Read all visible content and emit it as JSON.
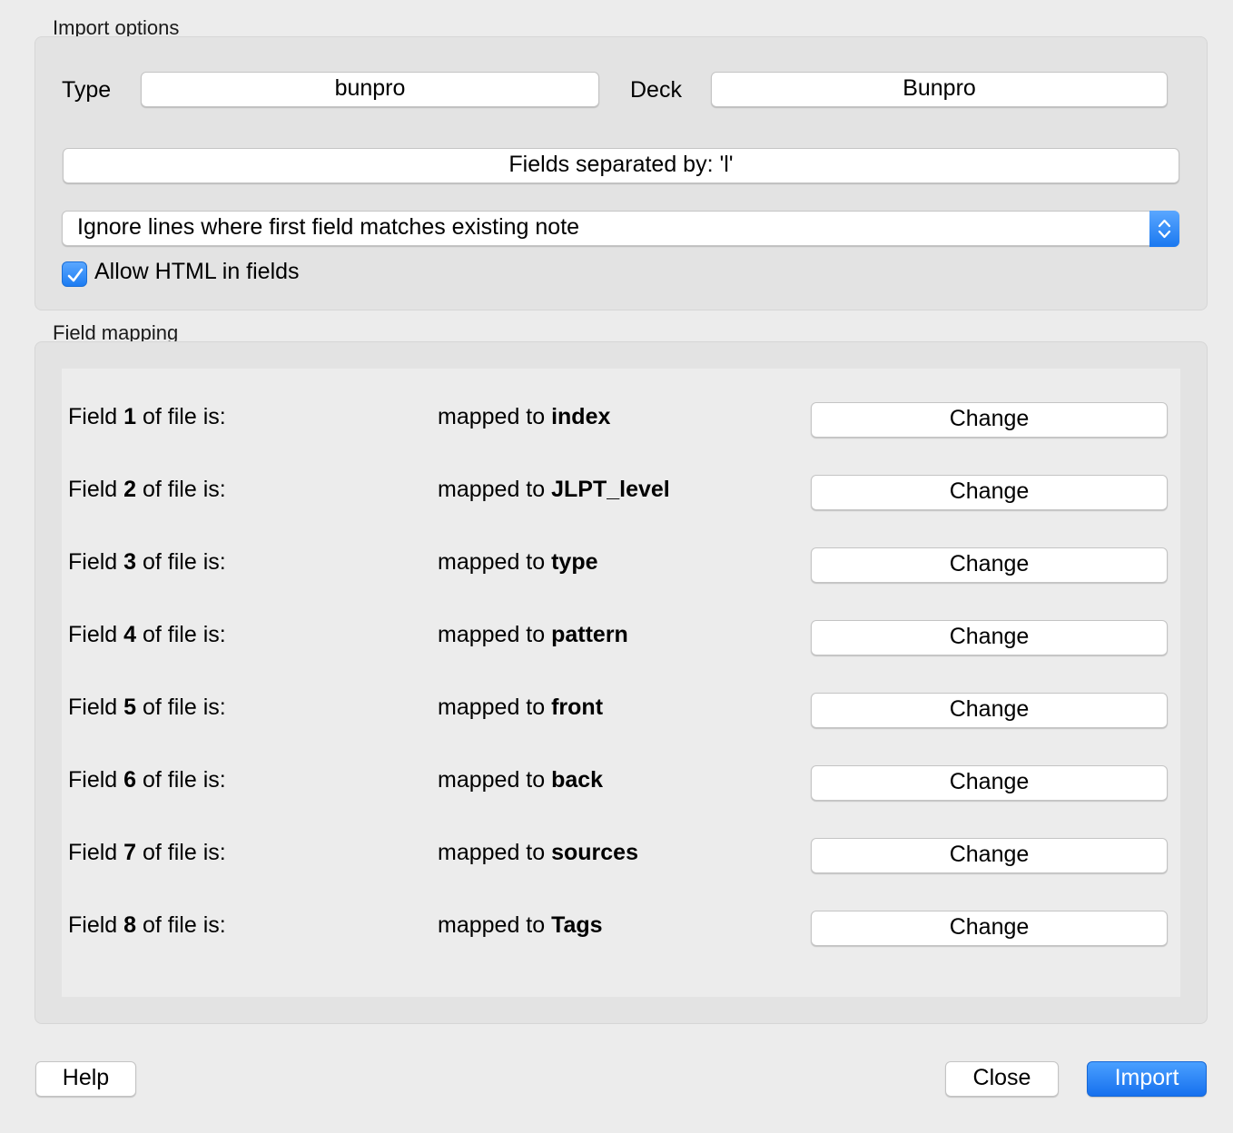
{
  "import_options": {
    "title": "Import options",
    "type_label": "Type",
    "type_value": "bunpro",
    "deck_label": "Deck",
    "deck_value": "Bunpro",
    "separator_button": "Fields separated by: 'l'",
    "duplicate_mode": "Ignore lines where first field matches existing note",
    "allow_html_label": "Allow HTML in fields",
    "allow_html_checked": true
  },
  "field_mapping": {
    "title": "Field mapping",
    "rows": [
      {
        "prefix": "Field ",
        "num": "1",
        "suffix": " of file is:",
        "mapped_prefix": "mapped to ",
        "target": "index",
        "button": "Change"
      },
      {
        "prefix": "Field ",
        "num": "2",
        "suffix": " of file is:",
        "mapped_prefix": "mapped to ",
        "target": "JLPT_level",
        "button": "Change"
      },
      {
        "prefix": "Field ",
        "num": "3",
        "suffix": " of file is:",
        "mapped_prefix": "mapped to ",
        "target": "type",
        "button": "Change"
      },
      {
        "prefix": "Field ",
        "num": "4",
        "suffix": " of file is:",
        "mapped_prefix": "mapped to ",
        "target": "pattern",
        "button": "Change"
      },
      {
        "prefix": "Field ",
        "num": "5",
        "suffix": " of file is:",
        "mapped_prefix": "mapped to ",
        "target": "front",
        "button": "Change"
      },
      {
        "prefix": "Field ",
        "num": "6",
        "suffix": " of file is:",
        "mapped_prefix": "mapped to ",
        "target": "back",
        "button": "Change"
      },
      {
        "prefix": "Field ",
        "num": "7",
        "suffix": " of file is:",
        "mapped_prefix": "mapped to ",
        "target": "sources",
        "button": "Change"
      },
      {
        "prefix": "Field ",
        "num": "8",
        "suffix": " of file is:",
        "mapped_prefix": "mapped to ",
        "target": "Tags",
        "button": "Change"
      }
    ]
  },
  "footer": {
    "help": "Help",
    "close": "Close",
    "import": "Import"
  },
  "colors": {
    "accent": "#1a78f0",
    "window_bg": "#ececec"
  }
}
